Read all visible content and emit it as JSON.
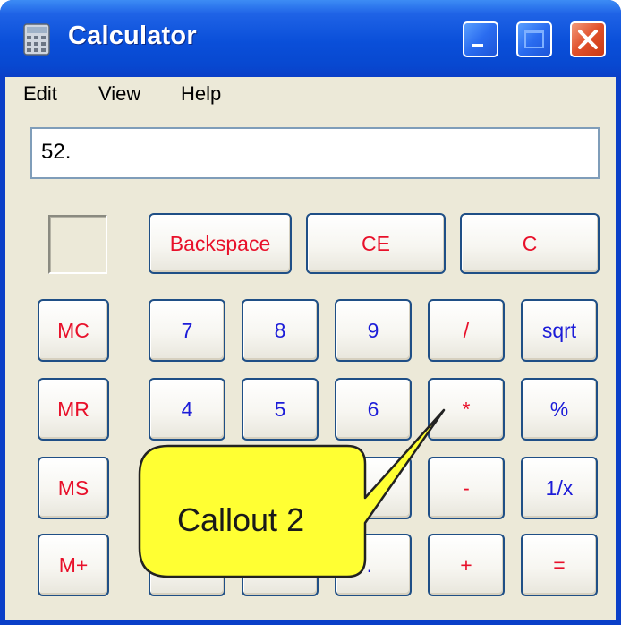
{
  "window": {
    "title": "Calculator",
    "icon": "calculator-icon",
    "controls": [
      "minimize-icon",
      "maximize-icon",
      "close-icon"
    ]
  },
  "menu": {
    "items": [
      "Edit",
      "View",
      "Help"
    ]
  },
  "display": {
    "value": "52."
  },
  "buttons": {
    "backspace": "Backspace",
    "ce": "CE",
    "c": "C",
    "mc": "MC",
    "mr": "MR",
    "ms": "MS",
    "mplus": "M+",
    "n7": "7",
    "n8": "8",
    "n9": "9",
    "divide": "/",
    "sqrt": "sqrt",
    "n4": "4",
    "n5": "5",
    "n6": "6",
    "multiply": "*",
    "percent": "%",
    "minus": "-",
    "reciprocal": "1/x",
    "decimal": ".",
    "plus": "+",
    "equals": "="
  },
  "callout": {
    "text": "Callout 2",
    "fill": "#ffff33"
  },
  "colors": {
    "titlebar": "#0a4fd9",
    "client": "#ece9d8",
    "red_label": "#e8102a",
    "blue_label": "#1c1cd8"
  }
}
